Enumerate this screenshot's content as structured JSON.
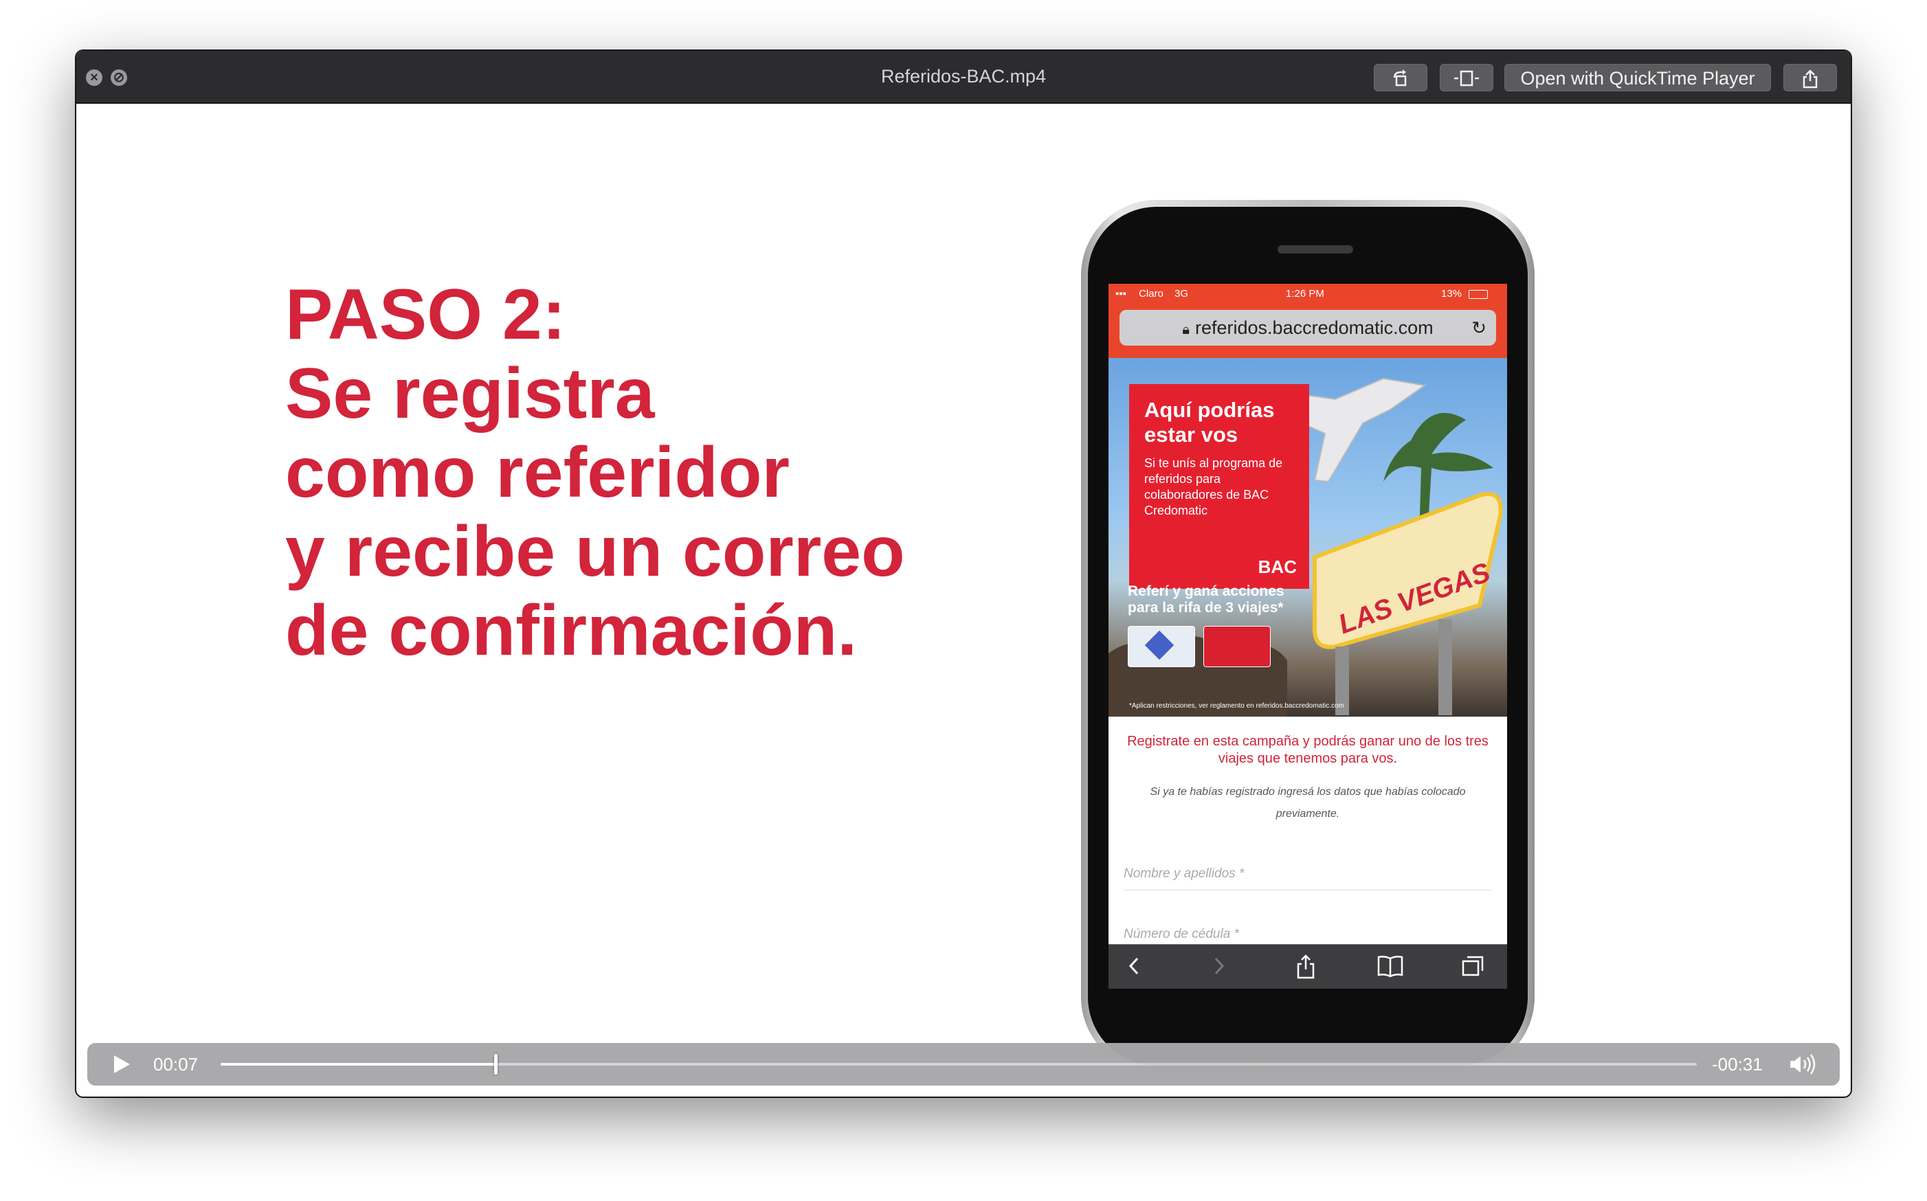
{
  "window": {
    "title": "Referidos-BAC.mp4",
    "open_with_label": "Open with QuickTime Player",
    "close_icon": "close-icon",
    "minimize_icon": "minimize-icon",
    "rotate_icon": "rotate-icon",
    "trim_icon": "trim-icon",
    "share_icon": "share-icon"
  },
  "headline": {
    "line1": "PASO 2:",
    "line2": "Se registra",
    "line3": "como referidor",
    "line4": "y recibe un correo",
    "line5": "de confirmación.",
    "color": "#d2243a"
  },
  "phone": {
    "status": {
      "carrier": "Claro",
      "network": "3G",
      "time": "1:26 PM",
      "battery": "13%"
    },
    "url": "referidos.baccredomatic.com",
    "banner": {
      "heading": "Aquí podrías estar vos",
      "body": "Si te unís al programa de referidos para colaboradores de BAC Credomatic",
      "logo": "BAC",
      "promo": "Referí y ganá acciones para la rifa de 3 viajes*",
      "sign": "LAS VEGAS",
      "fine_print": "*Aplican restricciones, ver reglamento en referidos.baccredomatic.com"
    },
    "form": {
      "intro": "Registrate en esta campaña y podrás ganar uno de los tres viajes que tenemos para vos.",
      "note": "Si ya te habías registrado ingresá los datos que habías colocado previamente.",
      "name_placeholder": "Nombre y apellidos *",
      "id_placeholder": "Número de cédula *"
    }
  },
  "player": {
    "elapsed": "00:07",
    "remaining": "-00:31",
    "progress": 0.186
  }
}
